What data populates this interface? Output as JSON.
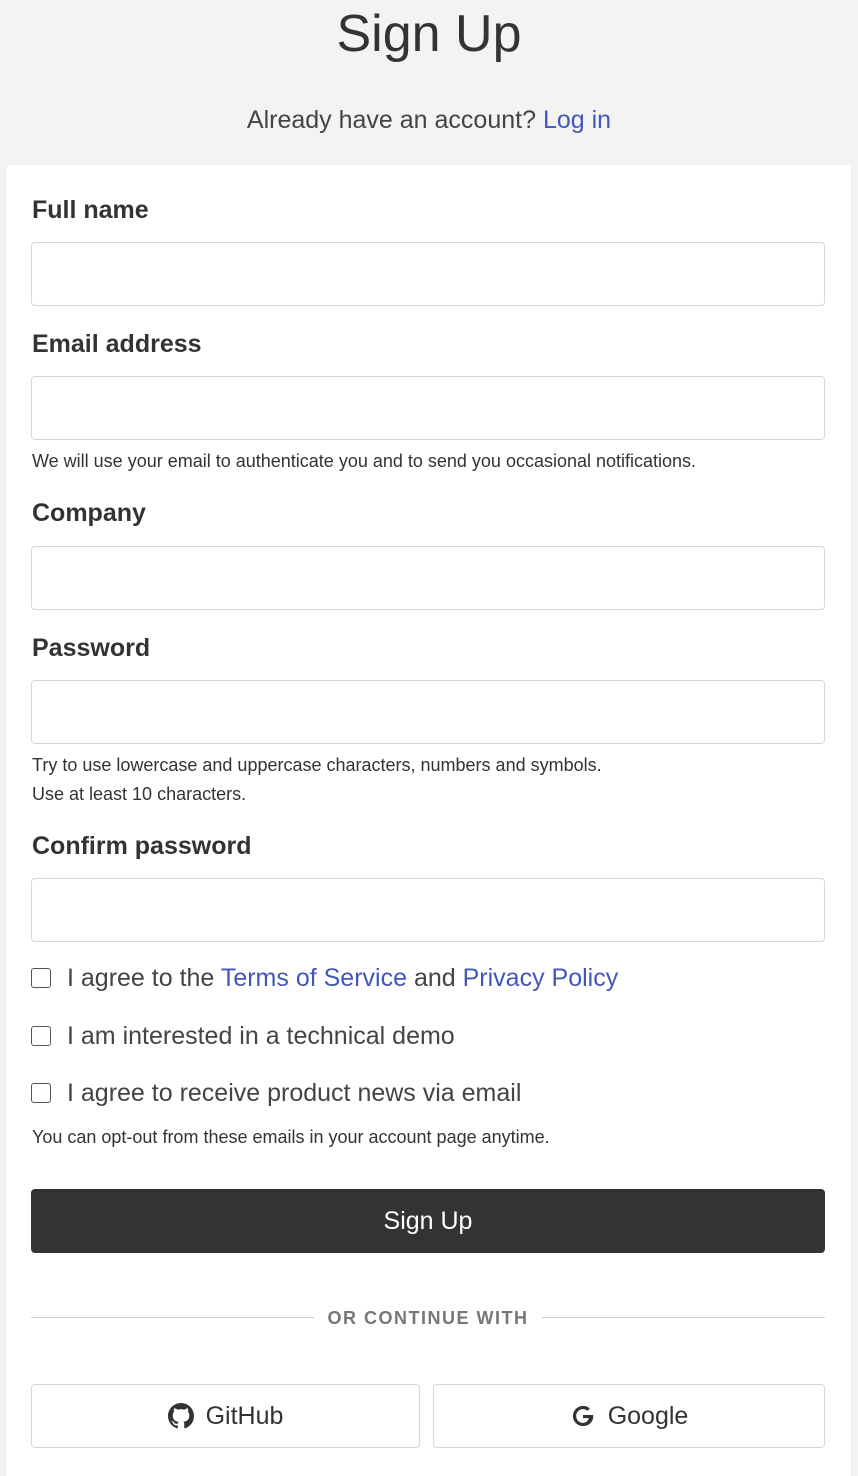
{
  "header": {
    "title": "Sign Up",
    "login_prompt": "Already have an account?",
    "login_link": "Log in"
  },
  "form": {
    "full_name_label": "Full name",
    "full_name_value": "",
    "email_label": "Email address",
    "email_value": "",
    "email_hint": "We will use your email to authenticate you and to send you occasional notifications.",
    "company_label": "Company",
    "company_value": "",
    "password_label": "Password",
    "password_value": "",
    "password_hint_1": "Try to use lowercase and uppercase characters, numbers and symbols.",
    "password_hint_2": "Use at least 10 characters.",
    "confirm_label": "Confirm password",
    "confirm_value": ""
  },
  "checkboxes": {
    "terms_prefix": "I agree to the",
    "terms_link": "Terms of Service",
    "terms_and": "and",
    "privacy_link": "Privacy Policy",
    "terms_checked": false,
    "demo_label": "I am interested in a technical demo",
    "demo_checked": false,
    "news_label": "I agree to receive product news via email",
    "news_checked": false,
    "news_hint": "You can opt-out from these emails in your account page anytime."
  },
  "submit_label": "Sign Up",
  "divider_text": "OR CONTINUE WITH",
  "social": {
    "github_label": "GitHub",
    "github_icon": "github-icon",
    "google_label": "Google",
    "google_icon": "google-icon"
  },
  "colors": {
    "background": "#f3f3f3",
    "link": "#4357b8",
    "primary_button": "#333333"
  }
}
